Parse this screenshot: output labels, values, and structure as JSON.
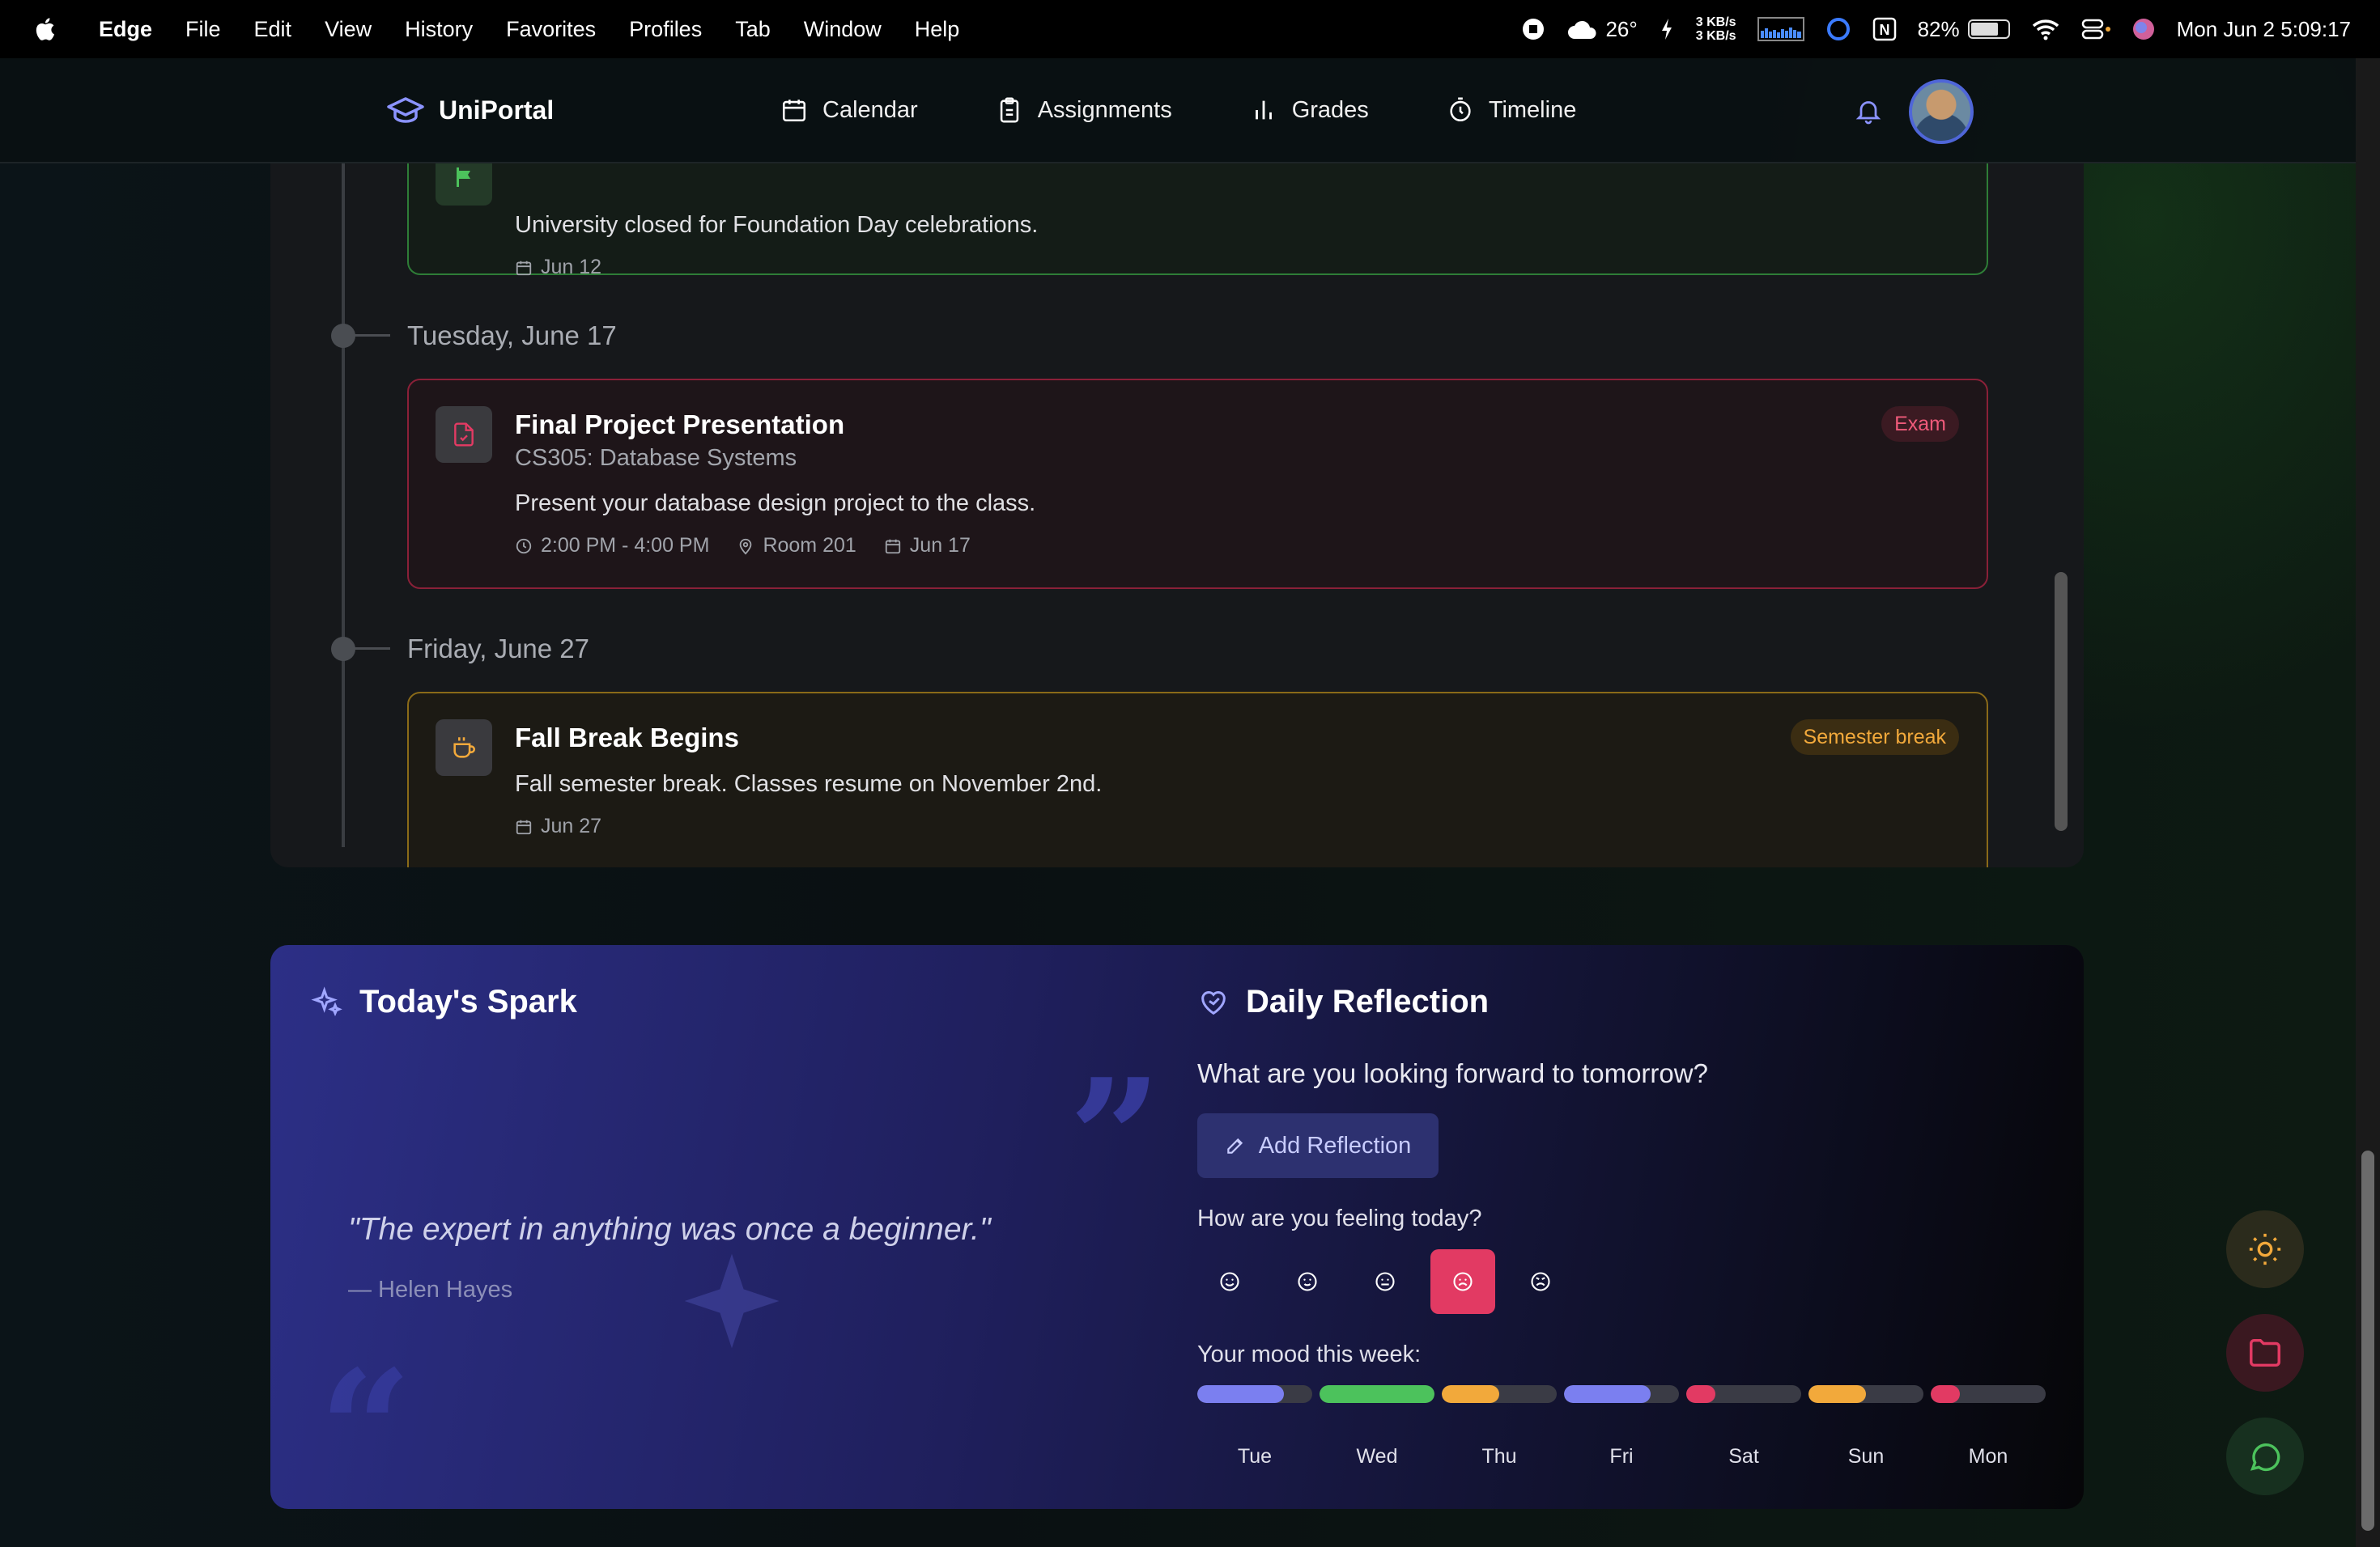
{
  "menubar": {
    "app": "Edge",
    "items": [
      "File",
      "Edit",
      "View",
      "History",
      "Favorites",
      "Profiles",
      "Tab",
      "Window",
      "Help"
    ],
    "weather": "26°",
    "net_up": "3 KB/s",
    "net_down": "3 KB/s",
    "battery": "82%",
    "datetime": "Mon Jun 2  5:09:17"
  },
  "nav": {
    "brand": "UniPortal",
    "links": [
      "Calendar",
      "Assignments",
      "Grades",
      "Timeline"
    ]
  },
  "timeline": {
    "events": [
      {
        "description": "University closed for Foundation Day celebrations.",
        "date": "Jun 12"
      },
      {
        "day": "Tuesday, June 17",
        "title": "Final Project Presentation",
        "course": "CS305: Database Systems",
        "description": "Present your database design project to the class.",
        "time": "2:00 PM - 4:00 PM",
        "location": "Room 201",
        "date": "Jun 17",
        "badge": "Exam"
      },
      {
        "day": "Friday, June 27",
        "title": "Fall Break Begins",
        "description": "Fall semester break. Classes resume on November 2nd.",
        "date": "Jun 27",
        "badge": "Semester break"
      }
    ]
  },
  "spark": {
    "title": "Today's Spark",
    "quote": "\"The expert in anything was once a beginner.\"",
    "author": "— Helen Hayes"
  },
  "reflection": {
    "title": "Daily Reflection",
    "prompt": "What are you looking forward to tomorrow?",
    "add_label": "Add Reflection",
    "feeling_label": "How are you feeling today?",
    "week_label": "Your mood this week:",
    "selected_mood_index": 3,
    "week": [
      {
        "day": "Tue",
        "level": 0.75,
        "color": "#7b7ff0"
      },
      {
        "day": "Wed",
        "level": 1.0,
        "color": "#4cc25c"
      },
      {
        "day": "Thu",
        "level": 0.5,
        "color": "#f2a93b"
      },
      {
        "day": "Fri",
        "level": 0.75,
        "color": "#7b7ff0"
      },
      {
        "day": "Sat",
        "level": 0.25,
        "color": "#e23a63"
      },
      {
        "day": "Sun",
        "level": 0.5,
        "color": "#f2a93b"
      },
      {
        "day": "Mon",
        "level": 0.25,
        "color": "#e23a63"
      }
    ]
  }
}
